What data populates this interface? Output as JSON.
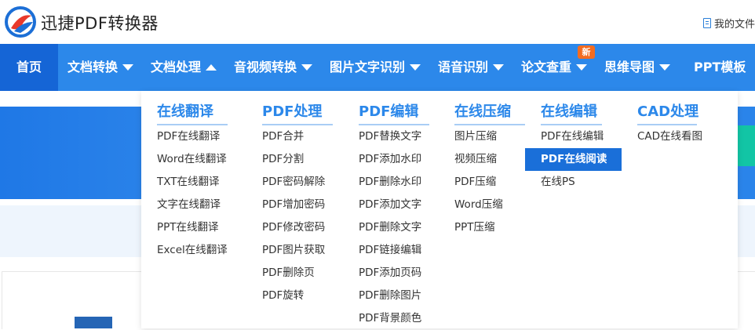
{
  "header": {
    "brand": "迅捷PDF转换器",
    "my_files": "我的文件"
  },
  "colors": {
    "nav": "#2c88ea",
    "nav_active": "#1565d6",
    "accent": "#2c88ea",
    "badge": "#f36c21",
    "highlight": "#1a6fd9"
  },
  "nav": {
    "items": [
      {
        "label": "首页",
        "arrow": ""
      },
      {
        "label": "文档转换",
        "arrow": "down"
      },
      {
        "label": "文档处理",
        "arrow": "up"
      },
      {
        "label": "音视频转换",
        "arrow": "down"
      },
      {
        "label": "图片文字识别",
        "arrow": "down"
      },
      {
        "label": "语音识别",
        "arrow": "down"
      },
      {
        "label": "论文查重",
        "arrow": "down"
      },
      {
        "label": "思维导图",
        "arrow": "down"
      },
      {
        "label": "PPT模板",
        "arrow": ""
      }
    ],
    "badge": "新"
  },
  "dropdown": {
    "columns": [
      {
        "title": "在线翻译",
        "items": [
          "PDF在线翻译",
          "Word在线翻译",
          "TXT在线翻译",
          "文字在线翻译",
          "PPT在线翻译",
          "Excel在线翻译"
        ]
      },
      {
        "title": "PDF处理",
        "items": [
          "PDF合并",
          "PDF分割",
          "PDF密码解除",
          "PDF增加密码",
          "PDF修改密码",
          "PDF图片获取",
          "PDF删除页",
          "PDF旋转"
        ]
      },
      {
        "title": "PDF编辑",
        "items": [
          "PDF替换文字",
          "PDF添加水印",
          "PDF删除水印",
          "PDF添加文字",
          "PDF删除文字",
          "PDF链接编辑",
          "PDF添加页码",
          "PDF删除图片",
          "PDF背景颜色"
        ]
      },
      {
        "title": "在线压缩",
        "items": [
          "图片压缩",
          "视频压缩",
          "PDF压缩",
          "Word压缩",
          "PPT压缩"
        ]
      },
      {
        "title": "在线编辑",
        "items": [
          "PDF在线编辑",
          "PDF在线阅读",
          "在线PS"
        ],
        "highlighted": "PDF在线阅读"
      },
      {
        "title": "CAD处理",
        "items": [
          "CAD在线看图"
        ]
      }
    ]
  }
}
